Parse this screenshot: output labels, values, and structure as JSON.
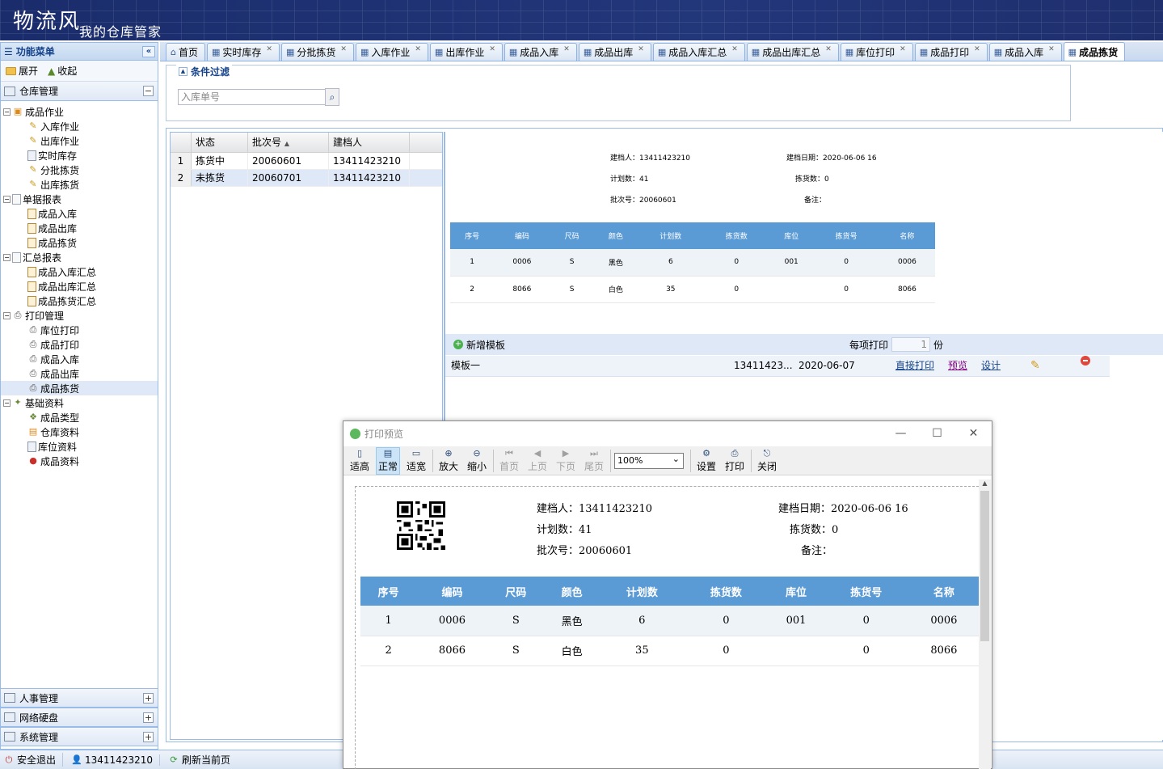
{
  "banner": {
    "title": "物流风",
    "subtitle": "我的仓库管家"
  },
  "leftmenu": {
    "header": "功能菜单",
    "expand_label": "展开",
    "collapse_label": "收起",
    "section_title": "仓库管理",
    "tree": [
      {
        "label": "成品作业",
        "level": 0,
        "icon": "folder-icon"
      },
      {
        "label": "入库作业",
        "level": 1,
        "icon": "pencil-icon"
      },
      {
        "label": "出库作业",
        "level": 1,
        "icon": "pencil-icon"
      },
      {
        "label": "实时库存",
        "level": 1,
        "icon": "grid-icon"
      },
      {
        "label": "分批拣货",
        "level": 1,
        "icon": "pencil-icon"
      },
      {
        "label": "出库拣货",
        "level": 1,
        "icon": "pencil-icon"
      },
      {
        "label": "单据报表",
        "level": 0,
        "icon": "doc-icon"
      },
      {
        "label": "成品入库",
        "level": 1,
        "icon": "report-icon"
      },
      {
        "label": "成品出库",
        "level": 1,
        "icon": "report-icon"
      },
      {
        "label": "成品拣货",
        "level": 1,
        "icon": "report-icon"
      },
      {
        "label": "汇总报表",
        "level": 0,
        "icon": "doc-icon"
      },
      {
        "label": "成品入库汇总",
        "level": 1,
        "icon": "report-icon"
      },
      {
        "label": "成品出库汇总",
        "level": 1,
        "icon": "report-icon"
      },
      {
        "label": "成品拣货汇总",
        "level": 1,
        "icon": "report-icon"
      },
      {
        "label": "打印管理",
        "level": 0,
        "icon": "printer-icon"
      },
      {
        "label": "库位打印",
        "level": 1,
        "icon": "printer-icon"
      },
      {
        "label": "成品打印",
        "level": 1,
        "icon": "printer-icon"
      },
      {
        "label": "成品入库",
        "level": 1,
        "icon": "printer-icon"
      },
      {
        "label": "成品出库",
        "level": 1,
        "icon": "printer-icon"
      },
      {
        "label": "成品拣货",
        "level": 1,
        "icon": "printer-icon",
        "selected": true
      },
      {
        "label": "基础资料",
        "level": 0,
        "icon": "wrench-icon"
      },
      {
        "label": "成品类型",
        "level": 1,
        "icon": "cube-icon"
      },
      {
        "label": "仓库资料",
        "level": 1,
        "icon": "box-icon"
      },
      {
        "label": "库位资料",
        "level": 1,
        "icon": "grid-icon"
      },
      {
        "label": "成品资料",
        "level": 1,
        "icon": "ball-icon"
      }
    ],
    "bottom_sections": [
      "人事管理",
      "网络硬盘",
      "系统管理"
    ]
  },
  "status": {
    "logout": "安全退出",
    "user": "13411423210",
    "refresh": "刷新当前页"
  },
  "tabs": [
    {
      "label": "首页",
      "closable": false
    },
    {
      "label": "实时库存",
      "closable": true
    },
    {
      "label": "分批拣货",
      "closable": true
    },
    {
      "label": "入库作业",
      "closable": true
    },
    {
      "label": "出库作业",
      "closable": true
    },
    {
      "label": "成品入库",
      "closable": true
    },
    {
      "label": "成品出库",
      "closable": true
    },
    {
      "label": "成品入库汇总",
      "closable": true
    },
    {
      "label": "成品出库汇总",
      "closable": true
    },
    {
      "label": "库位打印",
      "closable": true
    },
    {
      "label": "成品打印",
      "closable": true
    },
    {
      "label": "成品入库",
      "closable": true
    },
    {
      "label": "成品拣货",
      "closable": false,
      "active": true
    }
  ],
  "filter": {
    "legend": "条件过滤",
    "placeholder": "入库单号"
  },
  "grid": {
    "columns": [
      "状态",
      "批次号",
      "建档人"
    ],
    "sort_indicator": "▲",
    "rows": [
      {
        "n": "1",
        "status": "拣货中",
        "batch": "20060601",
        "creator": "13411423210"
      },
      {
        "n": "2",
        "status": "未拣货",
        "batch": "20060701",
        "creator": "13411423210"
      }
    ]
  },
  "preview_small": {
    "creator_label": "建档人：",
    "creator": "13411423210",
    "date_label": "建档日期：",
    "date": "2020-06-06 16",
    "plan_label": "计划数：",
    "plan": "41",
    "picked_label": "拣货数：",
    "picked": "0",
    "batch_label": "批次号：",
    "batch": "20060601",
    "remark_label": "备注：",
    "remark": ""
  },
  "detail_table": {
    "columns": [
      "序号",
      "编码",
      "尺码",
      "颜色",
      "计划数",
      "拣货数",
      "库位",
      "拣货号",
      "名称"
    ],
    "rows": [
      [
        "1",
        "0006",
        "S",
        "黑色",
        "6",
        "0",
        "001",
        "0",
        "0006"
      ],
      [
        "2",
        "8066",
        "S",
        "白色",
        "35",
        "0",
        "",
        "0",
        "8066"
      ]
    ]
  },
  "template_bar": {
    "add_label": "新增模板",
    "per_print_label": "每项打印",
    "copies": "1",
    "copies_unit": "份"
  },
  "template_row": {
    "name": "模板一",
    "creator": "13411423...",
    "date": "2020-06-07",
    "direct_print": "直接打印",
    "preview": "预览",
    "design": "设计"
  },
  "print_preview": {
    "title": "打印预览",
    "toolbar": [
      {
        "label": "适高",
        "icon": "▯"
      },
      {
        "label": "正常",
        "icon": "▤",
        "selected": true
      },
      {
        "label": "适宽",
        "icon": "▭"
      },
      {
        "label": "放大",
        "icon": "⊕"
      },
      {
        "label": "缩小",
        "icon": "⊖"
      },
      {
        "label": "首页",
        "icon": "⏮",
        "disabled": true
      },
      {
        "label": "上页",
        "icon": "◀",
        "disabled": true
      },
      {
        "label": "下页",
        "icon": "▶",
        "disabled": true
      },
      {
        "label": "尾页",
        "icon": "⏭",
        "disabled": true
      }
    ],
    "zoom": "100%",
    "toolbar_right": [
      {
        "label": "设置",
        "icon": "⚙"
      },
      {
        "label": "打印",
        "icon": "⎙"
      },
      {
        "label": "关闭",
        "icon": "⎋"
      }
    ]
  }
}
